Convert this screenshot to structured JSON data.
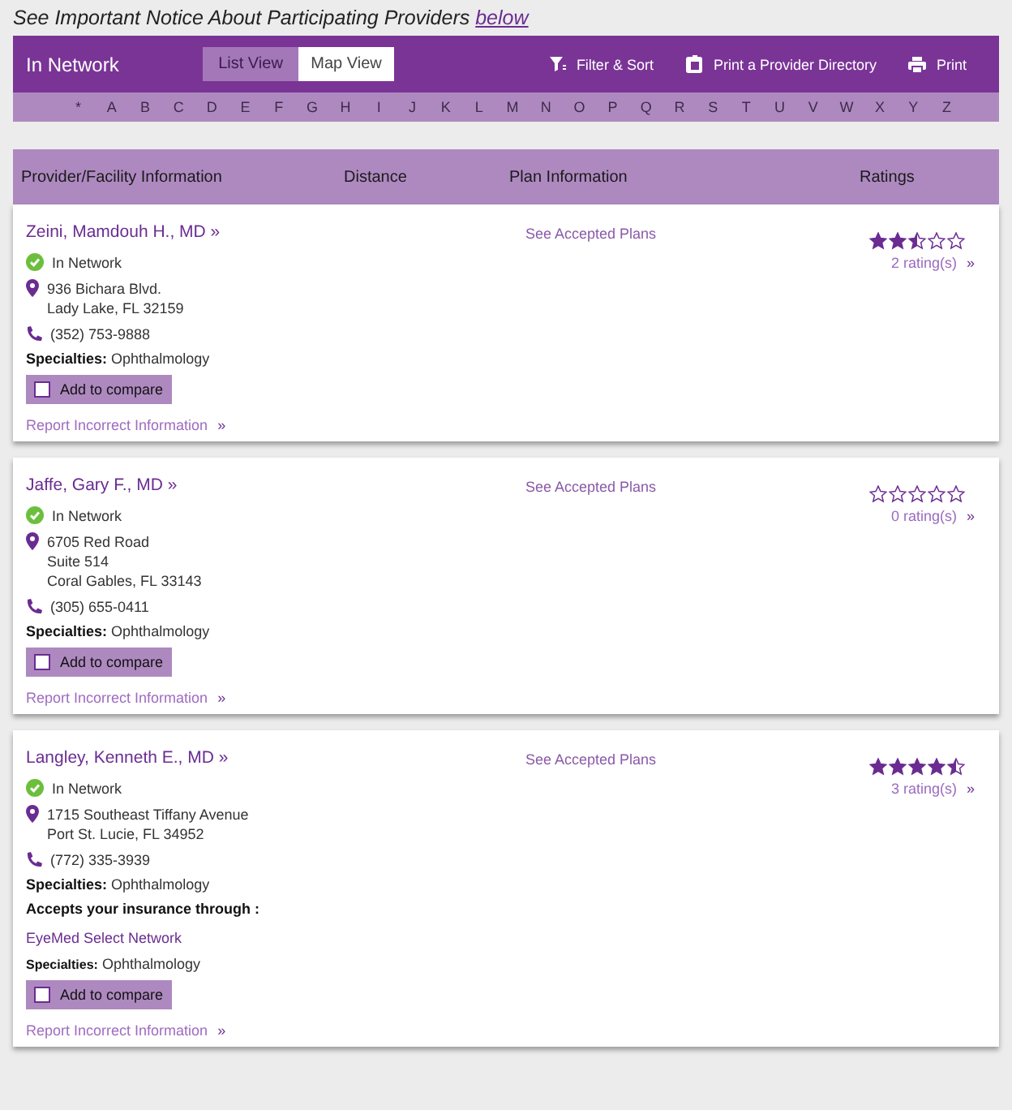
{
  "notice": {
    "text": "See Important Notice About Participating Providers",
    "link": "below"
  },
  "toolbar": {
    "title": "In Network",
    "views": [
      {
        "label": "List View",
        "selected": false
      },
      {
        "label": "Map View",
        "selected": true
      }
    ],
    "actions": [
      {
        "label": "Filter & Sort",
        "kind": "filter"
      },
      {
        "label": "Print a Provider Directory",
        "kind": "directory"
      },
      {
        "label": "Print",
        "kind": "print"
      }
    ]
  },
  "letters": [
    "*",
    "A",
    "B",
    "C",
    "D",
    "E",
    "F",
    "G",
    "H",
    "I",
    "J",
    "K",
    "L",
    "M",
    "N",
    "O",
    "P",
    "Q",
    "R",
    "S",
    "T",
    "U",
    "V",
    "W",
    "X",
    "Y",
    "Z"
  ],
  "columns": [
    "Provider/Facility Information",
    "Distance",
    "Plan Information",
    "Ratings"
  ],
  "providers": [
    {
      "name": "Zeini, Mamdouh H., MD »",
      "network": "In Network",
      "address_lines": [
        "936 Bichara Blvd.",
        "Lady Lake, FL 32159"
      ],
      "phone": "(352) 753-9888",
      "specialties_label": "Specialties:",
      "specialties": "Ophthalmology",
      "compare": {
        "label": "Add to compare",
        "checked": false
      },
      "report": "Report Incorrect Information",
      "report_arrow": "»",
      "plans": "See Accepted Plans",
      "stars": 2.5,
      "ratings": "2 rating(s)",
      "ratings_arrow": "»"
    },
    {
      "name": "Jaffe, Gary F., MD »",
      "network": "In Network",
      "address_lines": [
        "6705 Red Road",
        "Suite 514",
        "Coral Gables, FL 33143"
      ],
      "phone": "(305) 655-0411",
      "specialties_label": "Specialties:",
      "specialties": "Ophthalmology",
      "compare": {
        "label": "Add to compare",
        "checked": false
      },
      "report": "Report Incorrect Information",
      "report_arrow": "»",
      "plans": "See Accepted Plans",
      "stars": 0,
      "ratings": "0 rating(s)",
      "ratings_arrow": "»"
    },
    {
      "name": "Langley, Kenneth E., MD »",
      "network": "In Network",
      "address_lines": [
        "1715 Southeast Tiffany Avenue",
        "Port St. Lucie, FL 34952"
      ],
      "phone": "(772) 335-3939",
      "specialties_label": "Specialties:",
      "specialties": "Ophthalmology",
      "insurance": {
        "label": "Accepts your insurance through :",
        "network": "EyeMed Select Network",
        "specialties_label": "Specialties:",
        "specialties": "Ophthalmology"
      },
      "compare": {
        "label": "Add to compare",
        "checked": false
      },
      "report": "Report Incorrect Information",
      "report_arrow": "»",
      "plans": "See Accepted Plans",
      "stars": 4.5,
      "ratings": "3 rating(s)",
      "ratings_arrow": "»"
    }
  ]
}
